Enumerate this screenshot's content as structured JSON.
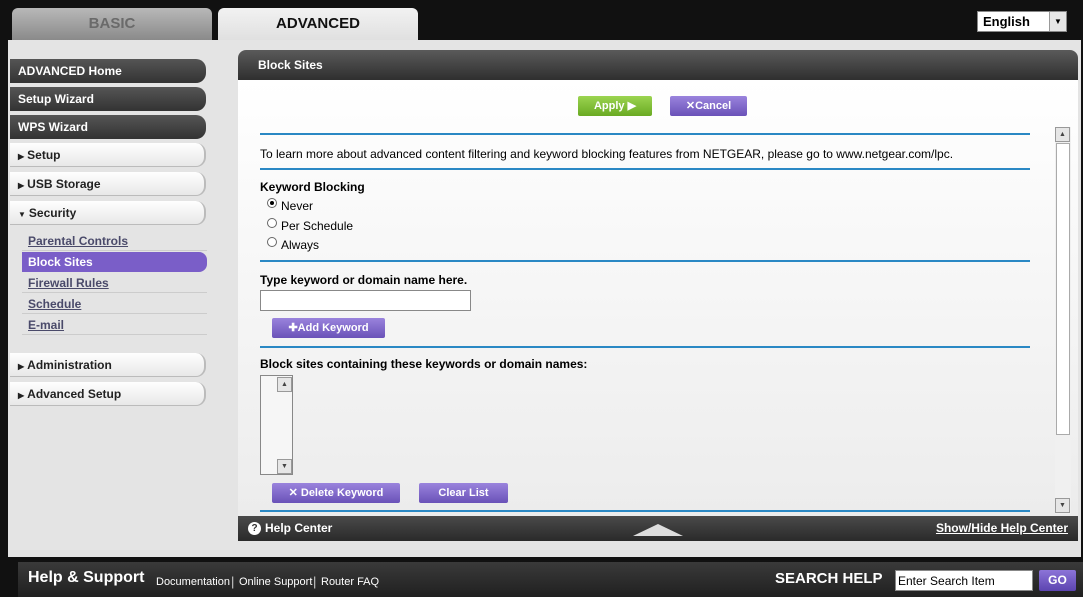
{
  "tabs": {
    "basic": "BASIC",
    "advanced": "ADVANCED"
  },
  "language": {
    "selected": "English"
  },
  "sidebar": {
    "advanced_home": "ADVANCED Home",
    "setup_wizard": "Setup Wizard",
    "wps_wizard": "WPS Wizard",
    "setup": "Setup",
    "usb_storage": "USB Storage",
    "security": "Security",
    "security_items": [
      "Parental Controls",
      "Block Sites",
      "Firewall Rules",
      "Schedule",
      "E-mail"
    ],
    "active_item": "Block Sites",
    "administration": "Administration",
    "advanced_setup": "Advanced Setup"
  },
  "panel": {
    "title": "Block Sites",
    "apply": "Apply ▶",
    "cancel": "Cancel",
    "info_text": "To learn more about advanced content filtering and keyword blocking features from NETGEAR, please go to www.netgear.com/lpc.",
    "keyword_blocking_label": "Keyword Blocking",
    "options": [
      "Never",
      "Per Schedule",
      "Always"
    ],
    "selected_option": "Never",
    "type_keyword_label": "Type keyword or domain name here.",
    "keyword_value": "",
    "add_keyword": "Add Keyword",
    "block_list_label": "Block sites containing these keywords or domain names:",
    "delete_keyword": "Delete Keyword",
    "clear_list": "Clear List"
  },
  "footer": {
    "help_center": "Help Center",
    "show_hide": "Show/Hide Help Center"
  },
  "bottom": {
    "title": "Help & Support",
    "links": [
      "Documentation",
      "Online Support",
      "Router FAQ"
    ],
    "search_label": "SEARCH HELP",
    "search_placeholder": "Enter Search Item",
    "go": "GO"
  },
  "colors": {
    "accent_purple": "#7a5ec8",
    "apply_green": "#7dc23a",
    "separator_blue": "#2a88c4"
  }
}
